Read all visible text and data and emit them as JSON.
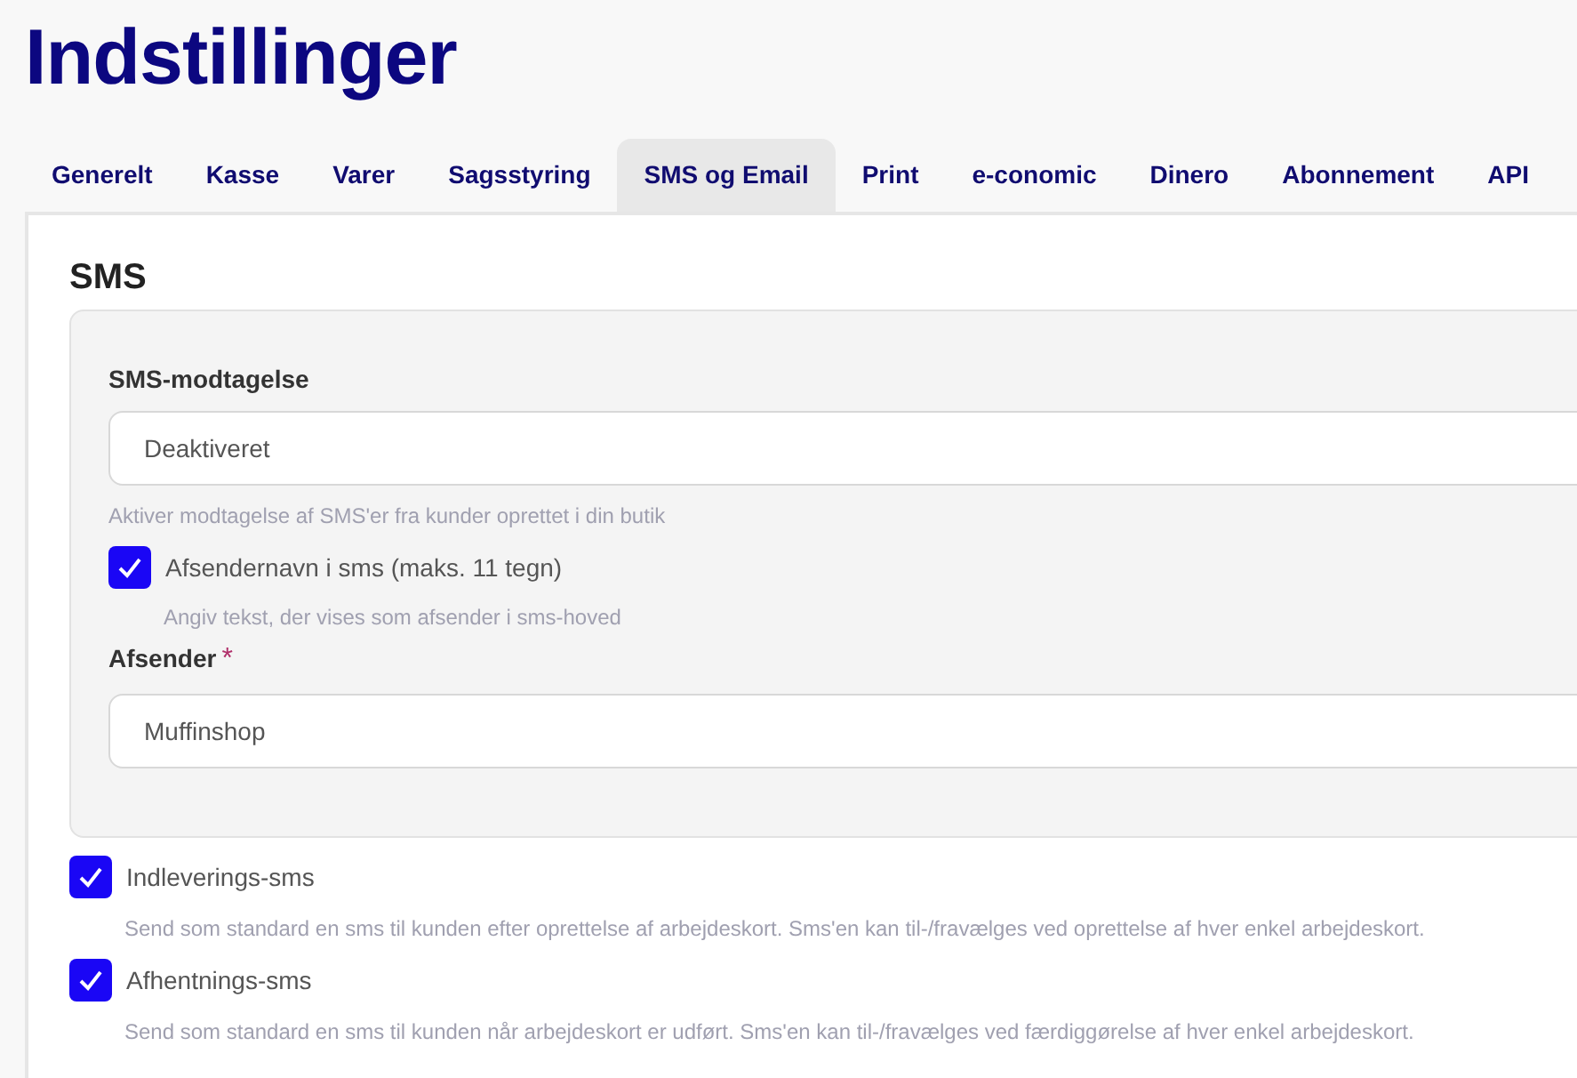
{
  "title": "Indstillinger",
  "tabs": [
    {
      "label": "Generelt",
      "selected": false
    },
    {
      "label": "Kasse",
      "selected": false
    },
    {
      "label": "Varer",
      "selected": false
    },
    {
      "label": "Sagsstyring",
      "selected": false
    },
    {
      "label": "SMS og Email",
      "selected": true
    },
    {
      "label": "Print",
      "selected": false
    },
    {
      "label": "e-conomic",
      "selected": false
    },
    {
      "label": "Dinero",
      "selected": false
    },
    {
      "label": "Abonnement",
      "selected": false
    },
    {
      "label": "API",
      "selected": false
    }
  ],
  "section": {
    "heading": "SMS",
    "box": {
      "receive_label": "SMS-modtagelse",
      "receive_value": "Deaktiveret",
      "receive_hint": "Aktiver modtagelse af SMS'er fra kunder oprettet i din butik",
      "sender_name": {
        "label": "Afsendernavn i sms (maks. 11 tegn)",
        "checked": true,
        "hint": "Angiv tekst, der vises som afsender i sms-hoved"
      },
      "sender_label": "Afsender",
      "sender_required": "*",
      "sender_value": "Muffinshop"
    },
    "options": [
      {
        "label": "Indleverings-sms",
        "checked": true,
        "hint": "Send som standard en sms til kunden efter oprettelse af arbejdeskort. Sms'en kan til-/fravælges ved oprettelse af hver enkel arbejdeskort."
      },
      {
        "label": "Afhentnings-sms",
        "checked": true,
        "hint": "Send som standard en sms til kunden når arbejdeskort er udført. Sms'en kan til-/fravælges ved færdiggørelse af hver enkel arbejdeskort."
      }
    ]
  }
}
